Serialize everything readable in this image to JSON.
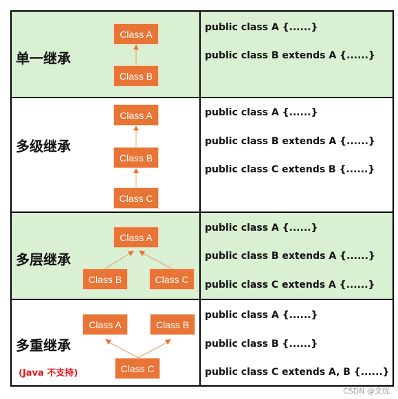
{
  "rows": [
    {
      "title": "单一继承",
      "boxes": [
        "Class A",
        "Class B"
      ],
      "code": [
        "public class A {......}",
        "public class B extends A {......}"
      ]
    },
    {
      "title": "多级继承",
      "boxes": [
        "Class A",
        "Class B",
        "Class C"
      ],
      "code": [
        "public class A {......}",
        "public class B extends A {......}",
        "public class C extends B {......}"
      ]
    },
    {
      "title": "多层继承",
      "boxes": [
        "Class A",
        "Class B",
        "Class C"
      ],
      "code": [
        "public class A {......}",
        "public class B extends A {......}",
        "public class C extends A {......}"
      ]
    },
    {
      "title": "多重继承",
      "note": "(Java 不支持)",
      "boxes": [
        "Class A",
        "Class B",
        "Class C"
      ],
      "code": [
        "public class A {......}",
        "public class B {......}",
        "public class C extends A, B {......}"
      ]
    }
  ],
  "colors": {
    "box": "#e87435",
    "arrow": "#f0a070",
    "green_row": "#d9f0d2",
    "note": "#e8101a"
  },
  "watermark": "CSDN @文优"
}
